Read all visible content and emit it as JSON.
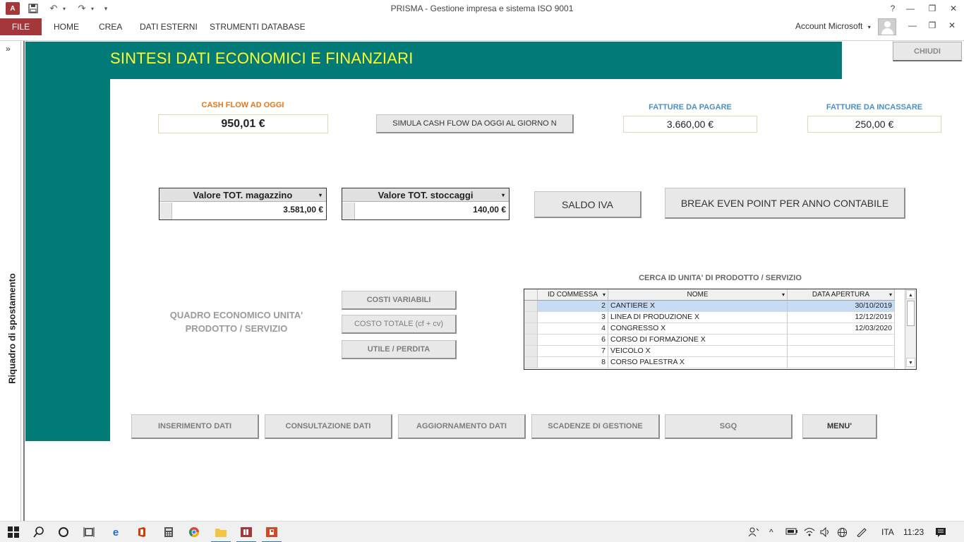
{
  "titlebar": {
    "title": "PRISMA - Gestione impresa e sistema ISO 9001",
    "access_logo": "A",
    "help": "?",
    "restore_glyph": "❐",
    "minimize_glyph": "—",
    "close_glyph": "✕",
    "undo_glyph": "↶",
    "redo_glyph": "↷",
    "customize_glyph": "▾"
  },
  "ribbon": {
    "file": "FILE",
    "tabs": [
      "HOME",
      "CREA",
      "DATI ESTERNI",
      "STRUMENTI DATABASE"
    ],
    "account": "Account Microsoft",
    "account_arrow": "▾"
  },
  "navpane": {
    "expand": "»",
    "label": "Riquadro di spostamento"
  },
  "form": {
    "title": "SINTESI DATI ECONOMICI E FINANZIARI",
    "close_button": "CHIUDI",
    "cash_flow_label": "CASH FLOW AD OGGI",
    "cash_flow_value": "950,01 €",
    "simulate_button": "SIMULA CASH FLOW DA OGGI AL GIORNO N",
    "fatture_pagare_label": "FATTURE DA PAGARE",
    "fatture_pagare_value": "3.660,00 €",
    "fatture_incassare_label": "FATTURE DA INCASSARE",
    "fatture_incassare_value": "250,00 €",
    "magazzino_header": "Valore TOT. magazzino",
    "magazzino_value": "3.581,00 €",
    "stoccaggi_header": "Valore TOT. stoccaggi",
    "stoccaggi_value": "140,00 €",
    "saldo_iva_button": "SALDO IVA",
    "break_even_button": "BREAK EVEN POINT PER ANNO CONTABILE",
    "quadro_label": "QUADRO ECONOMICO UNITA' PRODOTTO / SERVIZIO",
    "costi_variabili_button": "COSTI VARIABILI",
    "costo_totale_button": "COSTO TOTALE (cf + cv)",
    "utile_perdita_button": "UTILE / PERDITA",
    "search_label": "CERCA ID UNITA' DI PRODOTTO / SERVIZIO",
    "grid_headers": [
      "ID COMMESSA",
      "NOME",
      "DATA APERTURA"
    ],
    "grid_rows": [
      {
        "id": "2",
        "nome": "CANTIERE X",
        "data": "30/10/2019"
      },
      {
        "id": "3",
        "nome": "LINEA DI PRODUZIONE X",
        "data": "12/12/2019"
      },
      {
        "id": "4",
        "nome": "CONGRESSO X",
        "data": "12/03/2020"
      },
      {
        "id": "6",
        "nome": "CORSO DI FORMAZIONE X",
        "data": ""
      },
      {
        "id": "7",
        "nome": "VEICOLO X",
        "data": ""
      },
      {
        "id": "8",
        "nome": "CORSO PALESTRA X",
        "data": ""
      }
    ],
    "bottom_buttons": [
      "INSERIMENTO DATI",
      "CONSULTAZIONE DATI",
      "AGGIORNAMENTO DATI",
      "SCADENZE DI GESTIONE",
      "SGQ",
      "MENU'"
    ]
  },
  "taskbar": {
    "language": "ITA",
    "time": "11:23"
  },
  "colors": {
    "teal": "#027b78",
    "title_yellow": "#ffff2a",
    "access_red": "#a4373a",
    "orange_label": "#e8761a",
    "blue_label": "#4a90c8"
  }
}
